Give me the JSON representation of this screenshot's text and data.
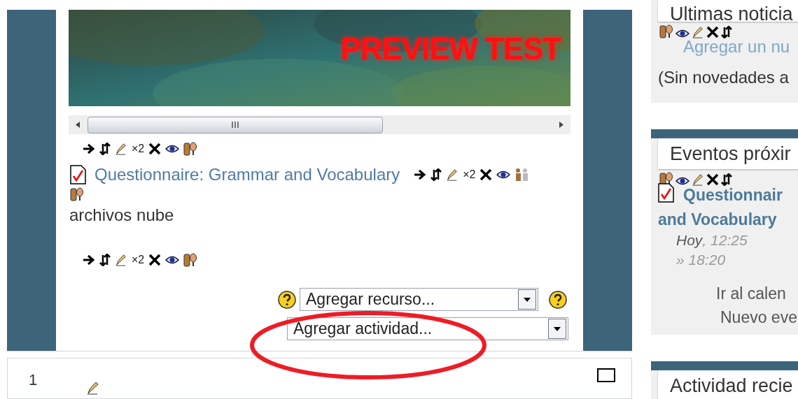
{
  "banner": {
    "title": "PREVIEW TEST"
  },
  "toolbar_1": [
    {
      "kind": "move"
    },
    {
      "kind": "updown"
    },
    {
      "kind": "edit"
    },
    {
      "kind": "text",
      "text": "×2"
    },
    {
      "kind": "delete"
    },
    {
      "kind": "hide"
    },
    {
      "kind": "groups"
    }
  ],
  "activity": {
    "title": "Questionnaire: Grammar and Vocabulary",
    "toolbar": [
      {
        "kind": "move"
      },
      {
        "kind": "updown"
      },
      {
        "kind": "edit"
      },
      {
        "kind": "text",
        "text": "×2"
      },
      {
        "kind": "delete"
      },
      {
        "kind": "hide"
      },
      {
        "kind": "groups-grey"
      },
      {
        "kind": "groups"
      }
    ]
  },
  "label_text": "archivos nube",
  "toolbar_2": [
    {
      "kind": "move"
    },
    {
      "kind": "updown"
    },
    {
      "kind": "edit"
    },
    {
      "kind": "text",
      "text": "×2"
    },
    {
      "kind": "delete"
    },
    {
      "kind": "hide"
    },
    {
      "kind": "groups"
    }
  ],
  "add_resource": {
    "value": "Agregar recurso..."
  },
  "add_activity": {
    "value": "Agregar actividad..."
  },
  "next_section": {
    "number": "1"
  },
  "blocks": [
    {
      "kind": "news",
      "title": "Ultimas noticia",
      "icons": [
        {
          "kind": "groups"
        },
        {
          "kind": "hide"
        },
        {
          "kind": "edit"
        },
        {
          "kind": "delete"
        },
        {
          "kind": "updown"
        }
      ],
      "link": "Agregar un nu",
      "note": "(Sin novedades a"
    },
    {
      "kind": "events",
      "title": "Eventos próxir",
      "icons": [
        {
          "kind": "groups"
        },
        {
          "kind": "hide"
        },
        {
          "kind": "edit"
        },
        {
          "kind": "delete"
        },
        {
          "kind": "updown"
        }
      ],
      "event_title": "Questionnair",
      "event_title_2": "and Vocabulary",
      "day": "Hoy",
      "time": ", 12:25",
      "end": "» 18:20",
      "links": [
        "Ir al calen",
        "Nuevo eve"
      ]
    },
    {
      "kind": "recent",
      "title": "Actividad recie"
    }
  ]
}
